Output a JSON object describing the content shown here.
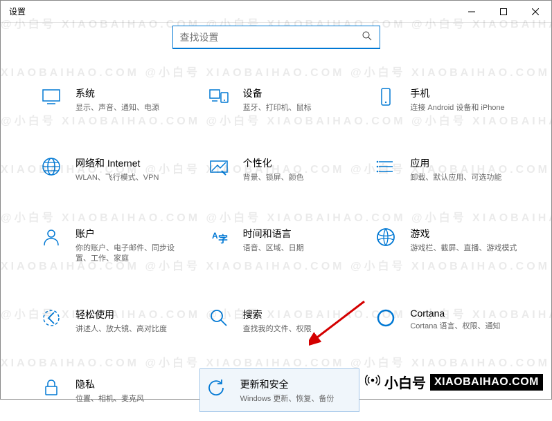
{
  "window": {
    "title": "设置"
  },
  "search": {
    "placeholder": "查找设置"
  },
  "categories": [
    {
      "id": "system",
      "title": "系统",
      "desc": "显示、声音、通知、电源"
    },
    {
      "id": "devices",
      "title": "设备",
      "desc": "蓝牙、打印机、鼠标"
    },
    {
      "id": "phone",
      "title": "手机",
      "desc": "连接 Android 设备和 iPhone"
    },
    {
      "id": "network",
      "title": "网络和 Internet",
      "desc": "WLAN、飞行模式、VPN"
    },
    {
      "id": "personalization",
      "title": "个性化",
      "desc": "背景、锁屏、颜色"
    },
    {
      "id": "apps",
      "title": "应用",
      "desc": "卸载、默认应用、可选功能"
    },
    {
      "id": "accounts",
      "title": "账户",
      "desc": "你的账户、电子邮件、同步设置、工作、家庭"
    },
    {
      "id": "time",
      "title": "时间和语言",
      "desc": "语音、区域、日期"
    },
    {
      "id": "gaming",
      "title": "游戏",
      "desc": "游戏栏、截屏、直播、游戏模式"
    },
    {
      "id": "ease",
      "title": "轻松使用",
      "desc": "讲述人、放大镜、高对比度"
    },
    {
      "id": "search",
      "title": "搜索",
      "desc": "查找我的文件、权限"
    },
    {
      "id": "cortana",
      "title": "Cortana",
      "desc": "Cortana 语言、权限、通知"
    },
    {
      "id": "privacy",
      "title": "隐私",
      "desc": "位置、相机、麦克风"
    },
    {
      "id": "update",
      "title": "更新和安全",
      "desc": "Windows 更新、恢复、备份",
      "highlight": true
    }
  ],
  "watermark": {
    "text_cn": "@小白号",
    "text_en": "XIAOBAIHAO.COM"
  },
  "badge": {
    "cn": "小白号",
    "en": "XIAOBAIHAO.COM"
  }
}
